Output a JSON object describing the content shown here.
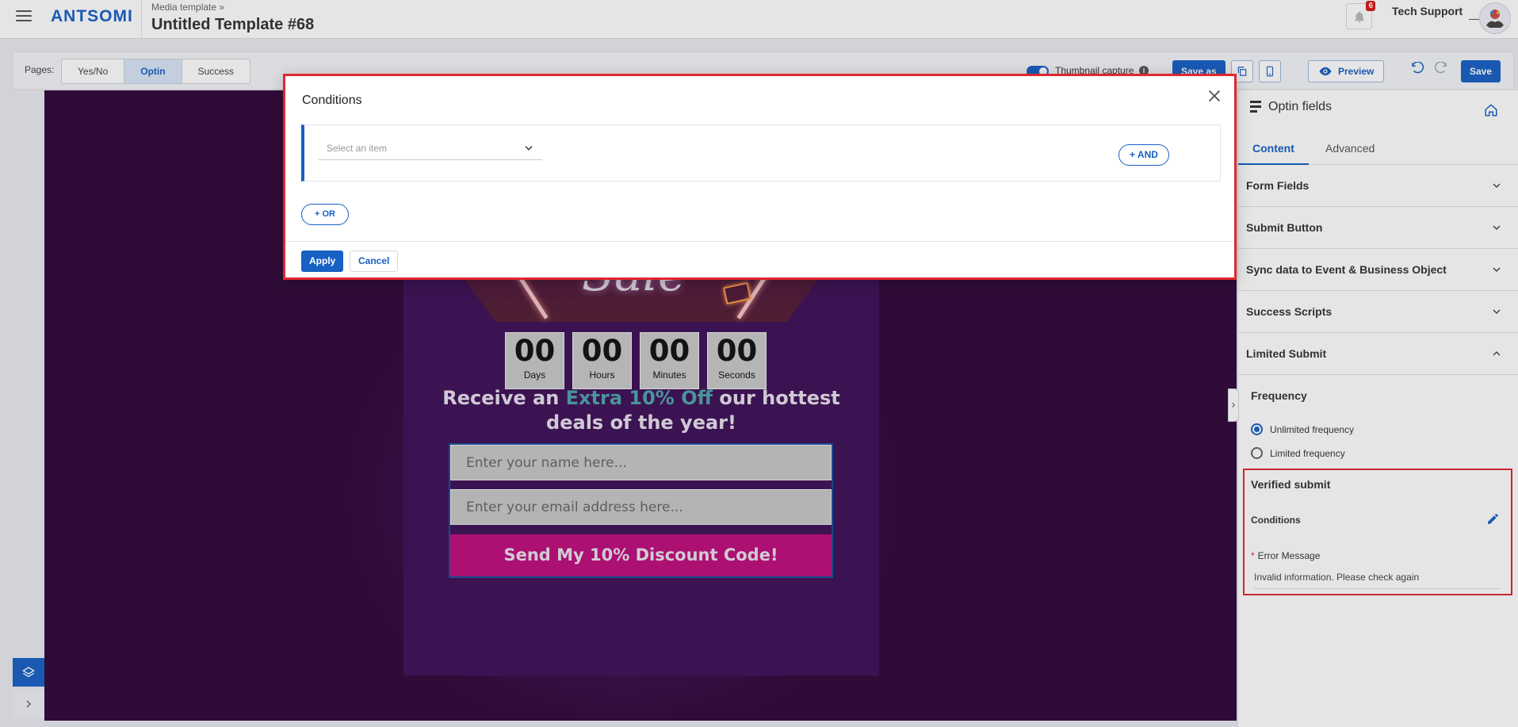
{
  "header": {
    "logo": "ANTSOMI",
    "breadcrumb": "Media template »",
    "title": "Untitled Template #68",
    "notifications_count": "6",
    "user_name": "Tech Support"
  },
  "toolbar": {
    "pages_label": "Pages:",
    "page_tabs": [
      "Yes/No",
      "Optin",
      "Success"
    ],
    "active_tab": "Optin",
    "thumbnail_label": "Thumbnail capture",
    "save_as_label": "Save as",
    "preview_label": "Preview",
    "save_label": "Save"
  },
  "canvas": {
    "sale_text": "Sale",
    "countdown": [
      {
        "value": "00",
        "label": "Days"
      },
      {
        "value": "00",
        "label": "Hours"
      },
      {
        "value": "00",
        "label": "Minutes"
      },
      {
        "value": "00",
        "label": "Seconds"
      }
    ],
    "headline_prefix": "Receive an",
    "headline_accent": "Extra 10% Off",
    "headline_suffix": "our hottest deals of the year!",
    "name_placeholder": "Enter your name here...",
    "email_placeholder": "Enter your email address here...",
    "submit_label": "Send My 10% Discount Code!"
  },
  "right_panel": {
    "title": "Optin fields",
    "tabs": [
      "Content",
      "Advanced"
    ],
    "sections": [
      "Form Fields",
      "Submit Button",
      "Sync data to Event & Business Object",
      "Success Scripts",
      "Limited Submit"
    ],
    "frequency_label": "Frequency",
    "frequency_options": [
      "Unlimited frequency",
      "Limited frequency"
    ],
    "selected_frequency": "Unlimited frequency",
    "verified_submit": {
      "title": "Verified submit",
      "conditions_label": "Conditions",
      "error_label": "Error Message",
      "error_value": "Invalid information. Please check again"
    }
  },
  "modal": {
    "title": "Conditions",
    "select_placeholder": "Select an item",
    "and_label": "+ AND",
    "or_label": "+ OR",
    "apply_label": "Apply",
    "cancel_label": "Cancel"
  },
  "colors": {
    "primary": "#1760c4",
    "highlight_border": "#e0272f",
    "canvas_bg": "#300838",
    "submit_button": "#bf0d7c",
    "accent_text": "#4fa3a9"
  }
}
